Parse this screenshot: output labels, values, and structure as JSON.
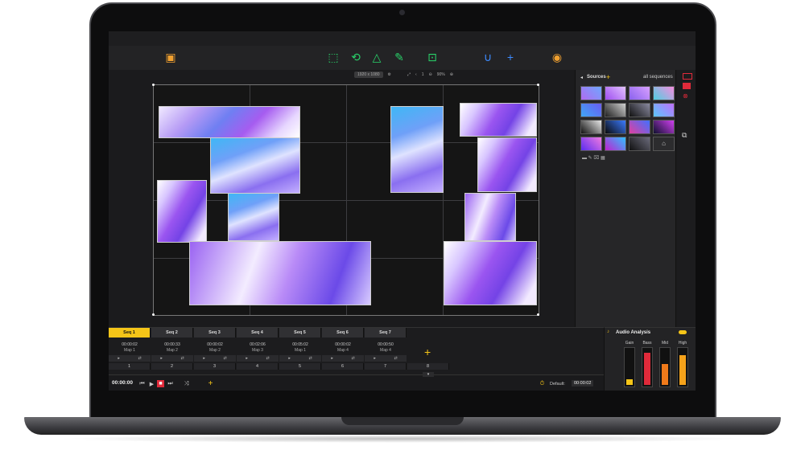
{
  "colors": {
    "accent": "#f5c518",
    "tool_green": "#29d36a",
    "tool_blue": "#3d8bff",
    "record_red": "#e02a3a"
  },
  "toolbar": {
    "icons": [
      "projector-icon",
      "rect-select-icon",
      "rotate-shape-icon",
      "triangle-point-icon",
      "pen-tool-icon",
      "crop-frame-icon",
      "magnet-icon",
      "plus-icon",
      "globe-icon"
    ]
  },
  "stage": {
    "resolution": "1920 x 1080",
    "page": "1",
    "zoom": "90%"
  },
  "sources": {
    "title": "Sources",
    "filter": "all sequences"
  },
  "sequences": [
    {
      "tab": "Seq 1",
      "time": "00:00:02",
      "map": "Map 1",
      "num": "1"
    },
    {
      "tab": "Seq 2",
      "time": "00:00:33",
      "map": "Map 2",
      "num": "2"
    },
    {
      "tab": "Seq 3",
      "time": "00:00:02",
      "map": "Map 2",
      "num": "3"
    },
    {
      "tab": "Seq 4",
      "time": "00:02:06",
      "map": "Map 3",
      "num": "4"
    },
    {
      "tab": "Seq 5",
      "time": "00:05:02",
      "map": "Map 1",
      "num": "5"
    },
    {
      "tab": "Seq 6",
      "time": "00:00:02",
      "map": "Map 4",
      "num": "6"
    },
    {
      "tab": "Seq 7",
      "time": "00:00:50",
      "map": "Map 4",
      "num": "7"
    }
  ],
  "seq_add_num": "8",
  "transport": {
    "time": "00:00:00",
    "default_label": "Default:",
    "default_value": "00:00:02"
  },
  "audio": {
    "title": "Audio Analysis",
    "bands": [
      {
        "label": "Gain",
        "level": 0.15,
        "color": "#f5c518"
      },
      {
        "label": "Bass",
        "level": 0.9,
        "color": "#e02a3a"
      },
      {
        "label": "Mid",
        "level": 0.6,
        "color": "#f07a1a"
      },
      {
        "label": "High",
        "level": 0.85,
        "color": "#f5a21a"
      }
    ]
  }
}
